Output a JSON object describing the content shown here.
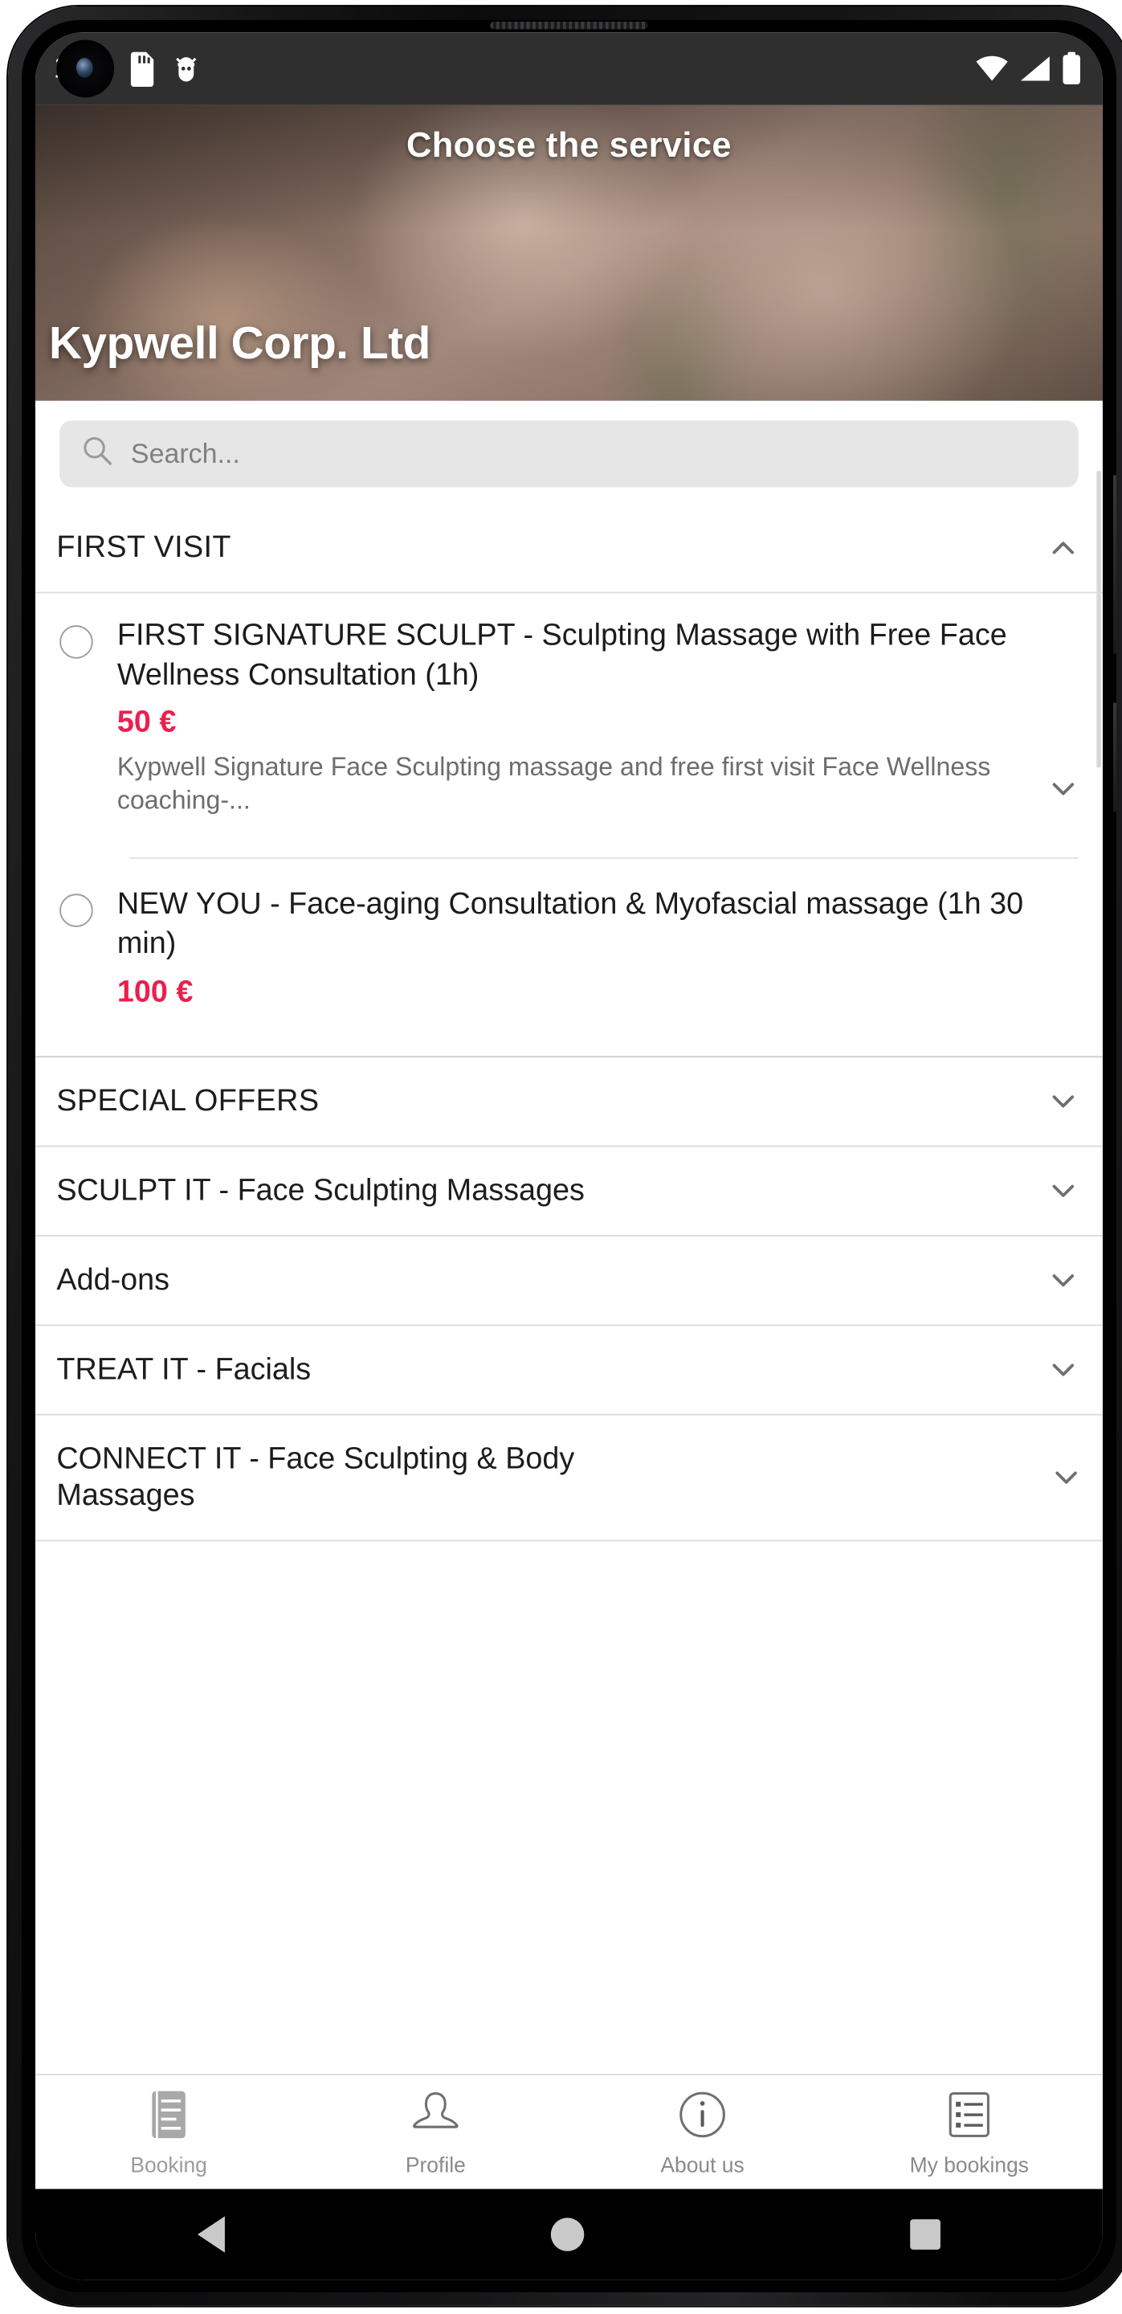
{
  "status_bar": {
    "notification_count": "1",
    "icons": [
      "sd-card-icon",
      "usb-debug-icon"
    ],
    "right_icons": [
      "wifi-icon",
      "cellular-signal-icon",
      "battery-icon"
    ]
  },
  "header": {
    "title": "Choose the service",
    "brand": "Kypwell Corp. Ltd"
  },
  "search": {
    "placeholder": "Search...",
    "value": ""
  },
  "categories": [
    {
      "label": "FIRST VISIT",
      "expanded": true,
      "services": [
        {
          "name": "FIRST SIGNATURE SCULPT - Sculpting Massage with Free Face Wellness Consultation (1h)",
          "price": "50 €",
          "description": "Kypwell Signature Face Sculpting massage and free first visit Face Wellness coaching-...",
          "selected": false,
          "has_more": true
        },
        {
          "name": "NEW YOU - Face-aging Consultation & Myofascial massage (1h 30 min)",
          "price": "100 €",
          "description": "",
          "selected": false,
          "has_more": false
        }
      ]
    },
    {
      "label": "SPECIAL OFFERS",
      "expanded": false,
      "services": []
    },
    {
      "label": "SCULPT IT - Face Sculpting Massages",
      "expanded": false,
      "services": []
    },
    {
      "label": "Add-ons",
      "expanded": false,
      "services": []
    },
    {
      "label": "TREAT IT - Facials",
      "expanded": false,
      "services": []
    },
    {
      "label": "CONNECT IT - Face Sculpting & Body Massages",
      "expanded": false,
      "services": []
    }
  ],
  "tabs": [
    {
      "label": "Booking",
      "icon": "booking-list-icon",
      "active": true
    },
    {
      "label": "Profile",
      "icon": "person-icon",
      "active": false
    },
    {
      "label": "About us",
      "icon": "info-circle-icon",
      "active": false
    },
    {
      "label": "My bookings",
      "icon": "my-bookings-list-icon",
      "active": false
    }
  ],
  "android_nav": {
    "back": "back-triangle-icon",
    "home": "home-circle-icon",
    "recents": "recents-square-icon"
  },
  "colors": {
    "price": "#ec1f4f",
    "status_bar_bg": "#2f2f2f",
    "search_bg": "#e6e6e6"
  }
}
